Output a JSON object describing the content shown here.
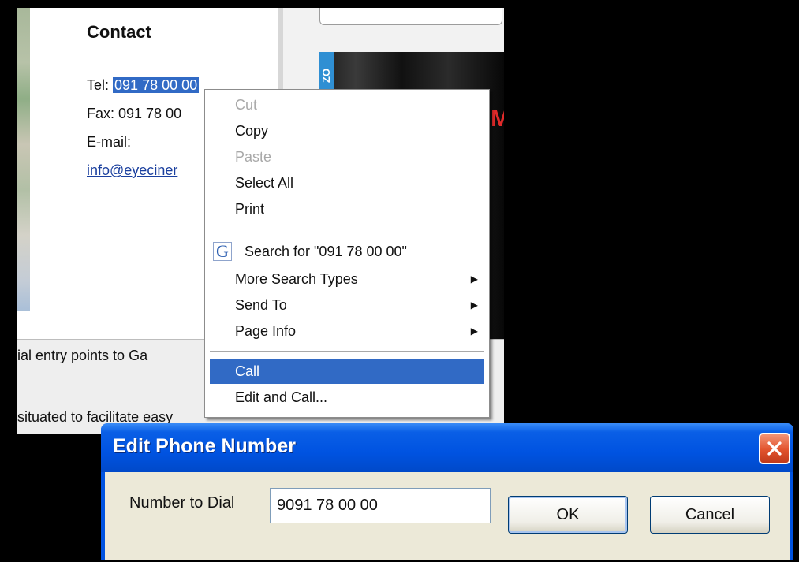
{
  "contact": {
    "title": "Contact",
    "tel_label": "Tel:",
    "tel_value": "091 78 00 00",
    "fax_line": "Fax: 091 78 00",
    "email_label": "E-mail:",
    "email_link": "info@eyeciner"
  },
  "page_text": {
    "line1": "ial entry points to Ga",
    "line2": "situated to facilitate easy"
  },
  "poster": {
    "side_text": "ZO",
    "letter": "M"
  },
  "context_menu": {
    "cut": "Cut",
    "copy": "Copy",
    "paste": "Paste",
    "select_all": "Select All",
    "print": "Print",
    "search_for": "Search for \"091 78 00 00\"",
    "more_search_types": "More Search Types",
    "send_to": "Send To",
    "page_info": "Page Info",
    "call": "Call",
    "edit_and_call": "Edit and Call..."
  },
  "dialog": {
    "title": "Edit Phone Number",
    "label": "Number to Dial",
    "number_value": "9091 78 00 00",
    "ok": "OK",
    "cancel": "Cancel"
  },
  "colors": {
    "selection": "#316ac5",
    "titlebar": "#0053e1",
    "dialog_body": "#ece9d8",
    "close_button": "#e2532d"
  },
  "icons": {
    "google": "google-g-icon",
    "submenu": "submenu-arrow-icon",
    "close": "close-icon"
  }
}
